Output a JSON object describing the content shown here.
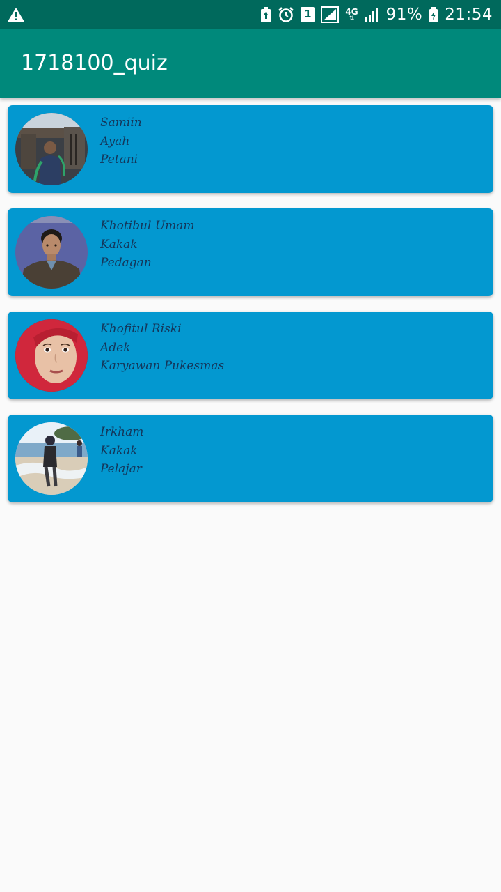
{
  "status_bar": {
    "battery": "91%",
    "time": "21:54",
    "network": "4G",
    "sim_slot": "1",
    "icons": [
      "warning-icon",
      "battery-saver-icon",
      "alarm-icon",
      "sim-icon",
      "signal-icon",
      "network-4g-icon",
      "signal-bars-icon",
      "battery-icon"
    ]
  },
  "app_bar": {
    "title": "1718100_quiz",
    "color": "#00897b"
  },
  "colors": {
    "status_bar": "#00695c",
    "card": "#0398d0",
    "card_text": "#14365a",
    "background": "#fafafa"
  },
  "people": [
    {
      "name": "Samiin",
      "relation": "Ayah",
      "job": "Petani",
      "photo": "avatar-photo-man-outdoors"
    },
    {
      "name": "Khotibul Umam",
      "relation": "Kakak",
      "job": "Pedagan",
      "photo": "avatar-photo-young-man"
    },
    {
      "name": "Khofitul Riski",
      "relation": "Adek",
      "job": "Karyawan Pukesmas",
      "photo": "avatar-photo-woman-red-hijab"
    },
    {
      "name": "Irkham",
      "relation": "Kakak",
      "job": "Pelajar",
      "photo": "avatar-photo-beach"
    }
  ]
}
